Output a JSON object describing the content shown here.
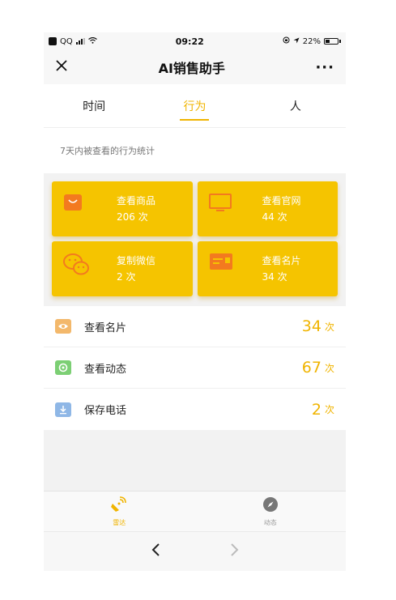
{
  "status_bar": {
    "carrier": "QQ",
    "time": "09:22",
    "battery": "22%"
  },
  "navbar": {
    "title": "AI销售助手",
    "more": "···"
  },
  "tabs": [
    {
      "label": "时间",
      "active": false
    },
    {
      "label": "行为",
      "active": true
    },
    {
      "label": "人",
      "active": false
    }
  ],
  "subtitle": "7天内被查看的行为统计",
  "cards": [
    {
      "label": "查看商品",
      "count": "206 次",
      "icon": "shopping-bag-icon"
    },
    {
      "label": "查看官网",
      "count": "44 次",
      "icon": "monitor-icon"
    },
    {
      "label": "复制微信",
      "count": "2 次",
      "icon": "wechat-icon"
    },
    {
      "label": "查看名片",
      "count": "34 次",
      "icon": "business-card-icon"
    }
  ],
  "list": [
    {
      "label": "查看名片",
      "count": "34",
      "unit": "次",
      "icon": "eye-icon",
      "color": "#f3b86b"
    },
    {
      "label": "查看动态",
      "count": "67",
      "unit": "次",
      "icon": "camera-icon",
      "color": "#7ccf74"
    },
    {
      "label": "保存电话",
      "count": "2",
      "unit": "次",
      "icon": "download-icon",
      "color": "#8fb7e6"
    }
  ],
  "tabbar": [
    {
      "label": "雷达",
      "icon": "radar-icon",
      "active": true
    },
    {
      "label": "动态",
      "icon": "compass-icon",
      "active": false
    }
  ],
  "colors": {
    "accent": "#f0b400",
    "card": "#f5c400"
  }
}
